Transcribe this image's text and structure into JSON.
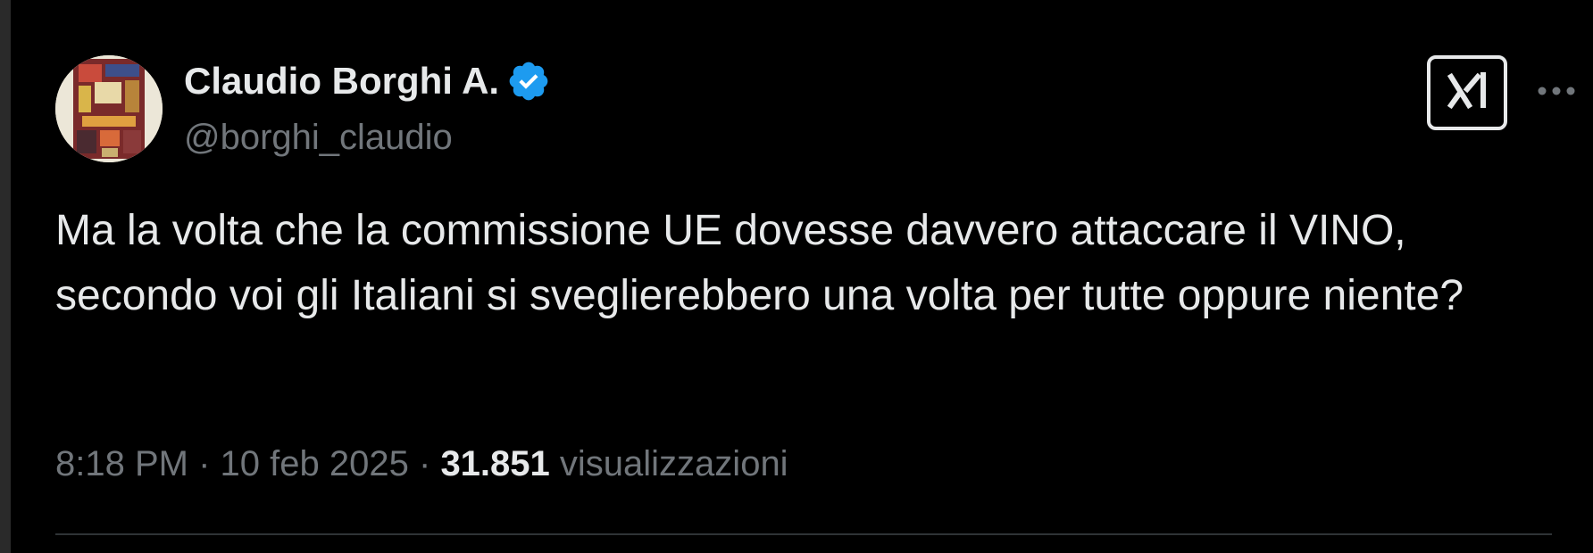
{
  "author": {
    "display_name": "Claudio Borghi A.",
    "handle": "@borghi_claudio",
    "verified": true,
    "avatar_icon": "avatar-image"
  },
  "tweet": {
    "text": "Ma la volta che la commissione UE dovesse davvero attaccare il VINO, secondo voi gli Italiani si sveglierebbero una volta per tutte oppure niente?"
  },
  "meta": {
    "time": "8:18 PM",
    "separator": "·",
    "date": "10 feb 2025",
    "views_count": "31.851",
    "views_label": "visualizzazioni"
  },
  "actions": {
    "grok_icon": "grok-icon",
    "more_icon": "more-icon"
  },
  "colors": {
    "background": "#000000",
    "primary_text": "#e7e9ea",
    "secondary_text": "#71767b",
    "verified_badge": "#1d9bf0",
    "divider": "#2f3336"
  }
}
